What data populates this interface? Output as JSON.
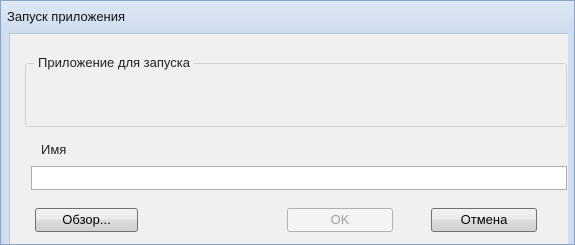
{
  "window": {
    "title": "Запуск приложения"
  },
  "group": {
    "legend": "Приложение для запуска"
  },
  "name": {
    "label": "Имя",
    "value": ""
  },
  "buttons": {
    "browse": "Обзор...",
    "ok": "OK",
    "cancel": "Отмена"
  }
}
